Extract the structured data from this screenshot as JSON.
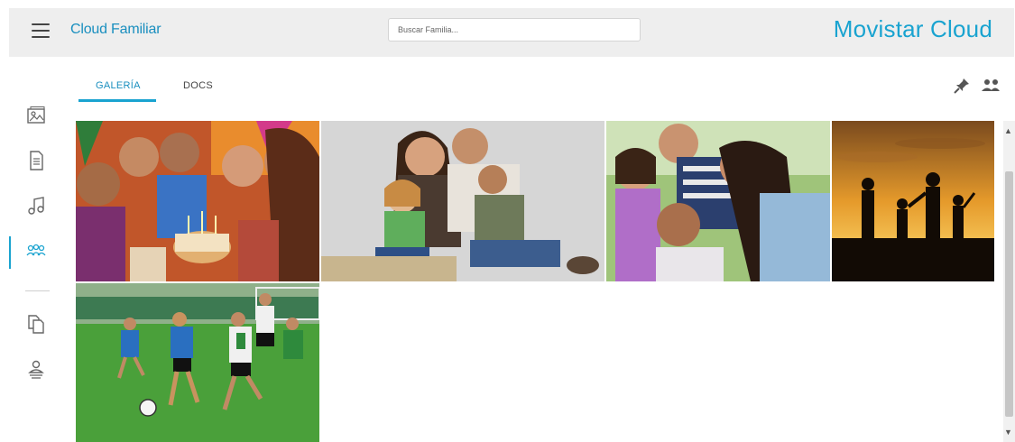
{
  "header": {
    "app_title": "Cloud Familiar",
    "search_placeholder": "Buscar Familia...",
    "brand": "Movistar Cloud"
  },
  "tabs": [
    {
      "label": "GALERÍA",
      "active": true
    },
    {
      "label": "DOCS",
      "active": false
    }
  ],
  "sidebar": {
    "items": [
      {
        "icon": "photos-icon"
      },
      {
        "icon": "document-icon"
      },
      {
        "icon": "music-icon"
      },
      {
        "icon": "family-icon",
        "active": true
      },
      {
        "icon": "copy-icon"
      },
      {
        "icon": "user-profile-icon"
      }
    ]
  },
  "toolbar": {
    "icons": [
      "pin-icon",
      "users-icon"
    ]
  },
  "gallery": {
    "photos": [
      {
        "subject": "birthday-party"
      },
      {
        "subject": "family-portrait"
      },
      {
        "subject": "family-outdoors"
      },
      {
        "subject": "family-sunset-silhouette"
      },
      {
        "subject": "kids-soccer"
      }
    ]
  },
  "colors": {
    "accent": "#19a3d0",
    "topbar_bg": "#eeeeee"
  }
}
